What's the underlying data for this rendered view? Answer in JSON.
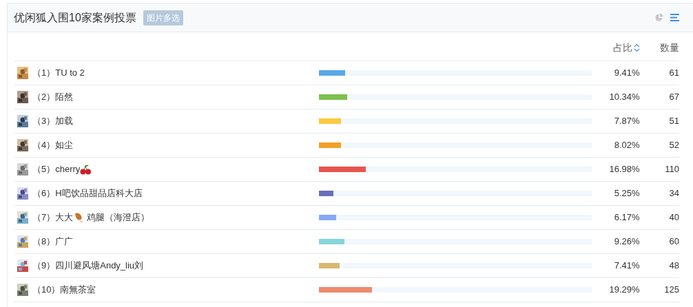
{
  "title": "优闲狐入围10家案例投票",
  "badge": "图片多选",
  "views": [
    {
      "kind": "pie",
      "selected": false
    },
    {
      "kind": "list",
      "selected": true
    }
  ],
  "columns": {
    "share": "占比",
    "count": "数量"
  },
  "rows": [
    {
      "label": "（1）TU to 2",
      "kind": "plain",
      "level": 0.0941,
      "color": "#5aa8ea",
      "percent": "9.41%",
      "count": "61"
    },
    {
      "label": "（2）陌然",
      "kind": "plain",
      "level": 0.1034,
      "color": "#7cc04b",
      "percent": "10.34%",
      "count": "67"
    },
    {
      "label": "（3）加载",
      "kind": "plain",
      "level": 0.0787,
      "color": "#fcc93f",
      "percent": "7.87%",
      "count": "51"
    },
    {
      "label": "（4）如尘",
      "kind": "plain",
      "level": 0.0802,
      "color": "#f4a024",
      "percent": "8.02%",
      "count": "52"
    },
    {
      "label": "（5）cherry",
      "kind": "cherry",
      "level": 0.1698,
      "color": "#e8554f",
      "percent": "16.98%",
      "count": "110"
    },
    {
      "label": "（6）H吧饮品甜品店科大店",
      "kind": "plain",
      "level": 0.0525,
      "color": "#6870b9",
      "percent": "5.25%",
      "count": "34"
    },
    {
      "label": "（7）大大",
      "kind": "drumstick",
      "label_after": "鸡腿（海澄店）",
      "level": 0.0617,
      "color": "#86a8f7",
      "percent": "6.17%",
      "count": "40"
    },
    {
      "label": "（8）广广",
      "kind": "plain",
      "level": 0.0926,
      "color": "#86d6dc",
      "percent": "9.26%",
      "count": "60"
    },
    {
      "label": "（9）四川避风塘Andy_liu刘",
      "kind": "plain",
      "level": 0.0741,
      "color": "#d9b86f",
      "percent": "7.41%",
      "count": "48"
    },
    {
      "label": "（10）南無茶室",
      "kind": "plain",
      "level": 0.1929,
      "color": "#ee8a6d",
      "percent": "19.29%",
      "count": "125"
    }
  ]
}
